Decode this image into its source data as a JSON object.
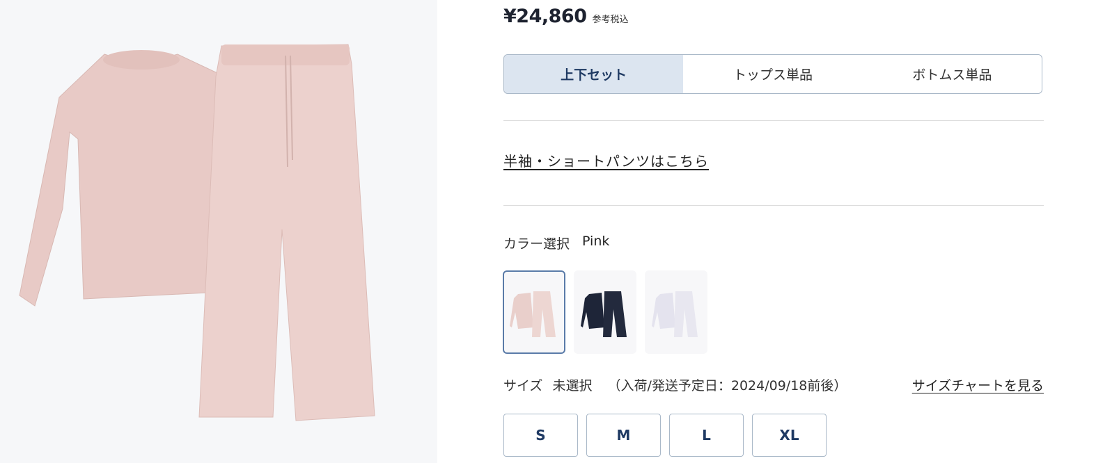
{
  "price": {
    "value": "¥24,860",
    "note": "参考税込"
  },
  "set_tabs": [
    {
      "label": "上下セット",
      "active": true
    },
    {
      "label": "トップス単品",
      "active": false
    },
    {
      "label": "ボトムス単品",
      "active": false
    }
  ],
  "alt_link": "半袖・ショートパンツはこちら",
  "color": {
    "label": "カラー選択",
    "selected": "Pink"
  },
  "swatch_colors": [
    "#e9cfcb",
    "#1e2538",
    "#e4e3ee"
  ],
  "size": {
    "label": "サイズ",
    "status": "未選択",
    "ship_note": "（入荷/発送予定日：2024/09/18前後）",
    "chart_link": "サイズチャートを見る",
    "options": [
      "S",
      "M",
      "L",
      "XL"
    ]
  },
  "colors": {
    "accent": "#1f3a63",
    "active_tab_bg": "#dce5f0",
    "border": "#a9b8c8",
    "garment": "#e9cdc9"
  }
}
